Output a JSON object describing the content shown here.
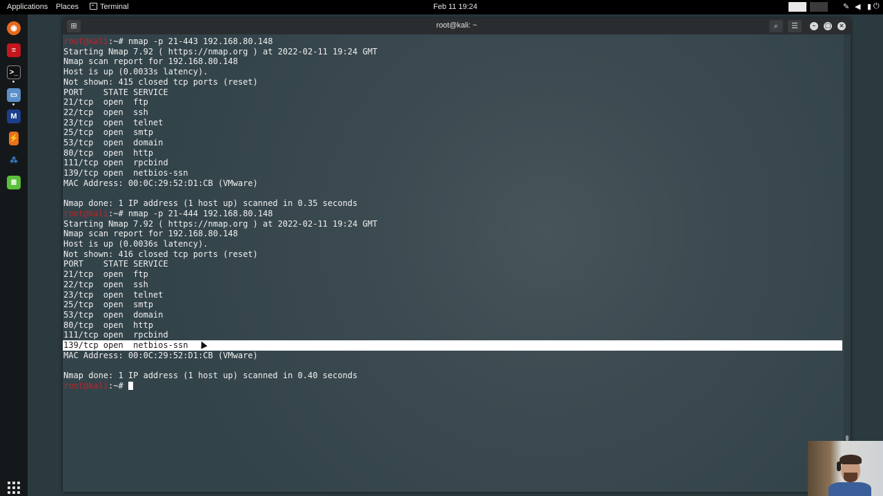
{
  "topbar": {
    "applications": "Applications",
    "places": "Places",
    "terminal": "Terminal",
    "datetime": "Feb 11  19:24",
    "tray_icons": [
      "pen-icon",
      "volume-icon",
      "battery-icon",
      "power-icon"
    ]
  },
  "dock": {
    "items": [
      "firefox-icon",
      "task-manager-icon",
      "terminal-icon",
      "files-icon",
      "metasploit-icon",
      "burpsuite-icon",
      "maltego-icon",
      "notes-icon"
    ],
    "apps_grid": "show-applications-icon"
  },
  "window": {
    "title": "root@kali: ~",
    "buttons": [
      "new-tab-icon",
      "search-icon",
      "menu-icon",
      "minimize-icon",
      "maximize-icon",
      "close-icon"
    ]
  },
  "terminal": {
    "prompt_label": "root@kali",
    "lines": [
      {
        "prompt": "root@kali",
        "text": ":~# nmap -p 21-443 192.168.80.148"
      },
      {
        "text": "Starting Nmap 7.92 ( https://nmap.org ) at 2022-02-11 19:24 GMT"
      },
      {
        "text": "Nmap scan report for 192.168.80.148"
      },
      {
        "text": "Host is up (0.0033s latency)."
      },
      {
        "text": "Not shown: 415 closed tcp ports (reset)"
      },
      {
        "text": "PORT    STATE SERVICE"
      },
      {
        "text": "21/tcp  open  ftp"
      },
      {
        "text": "22/tcp  open  ssh"
      },
      {
        "text": "23/tcp  open  telnet"
      },
      {
        "text": "25/tcp  open  smtp"
      },
      {
        "text": "53/tcp  open  domain"
      },
      {
        "text": "80/tcp  open  http"
      },
      {
        "text": "111/tcp open  rpcbind"
      },
      {
        "text": "139/tcp open  netbios-ssn"
      },
      {
        "text": "MAC Address: 00:0C:29:52:D1:CB (VMware)"
      },
      {
        "text": ""
      },
      {
        "text": "Nmap done: 1 IP address (1 host up) scanned in 0.35 seconds"
      },
      {
        "prompt": "root@kali",
        "text": ":~# nmap -p 21-444 192.168.80.148"
      },
      {
        "text": "Starting Nmap 7.92 ( https://nmap.org ) at 2022-02-11 19:24 GMT"
      },
      {
        "text": "Nmap scan report for 192.168.80.148"
      },
      {
        "text": "Host is up (0.0036s latency)."
      },
      {
        "text": "Not shown: 416 closed tcp ports (reset)"
      },
      {
        "text": "PORT    STATE SERVICE"
      },
      {
        "text": "21/tcp  open  ftp"
      },
      {
        "text": "22/tcp  open  ssh"
      },
      {
        "text": "23/tcp  open  telnet"
      },
      {
        "text": "25/tcp  open  smtp"
      },
      {
        "text": "53/tcp  open  domain"
      },
      {
        "text": "80/tcp  open  http"
      },
      {
        "text": "111/tcp open  rpcbind"
      },
      {
        "text": "139/tcp open  netbios-ssn",
        "selected": true
      },
      {
        "text": "MAC Address: 00:0C:29:52:D1:CB (VMware)"
      },
      {
        "text": ""
      },
      {
        "text": "Nmap done: 1 IP address (1 host up) scanned in 0.40 seconds"
      },
      {
        "prompt": "root@kali",
        "text": ":~# ",
        "cursor": true
      }
    ]
  },
  "colors": {
    "prompt": "#c0222a",
    "terminal_bg": "#3a4a50",
    "selection": "#ffffff"
  }
}
